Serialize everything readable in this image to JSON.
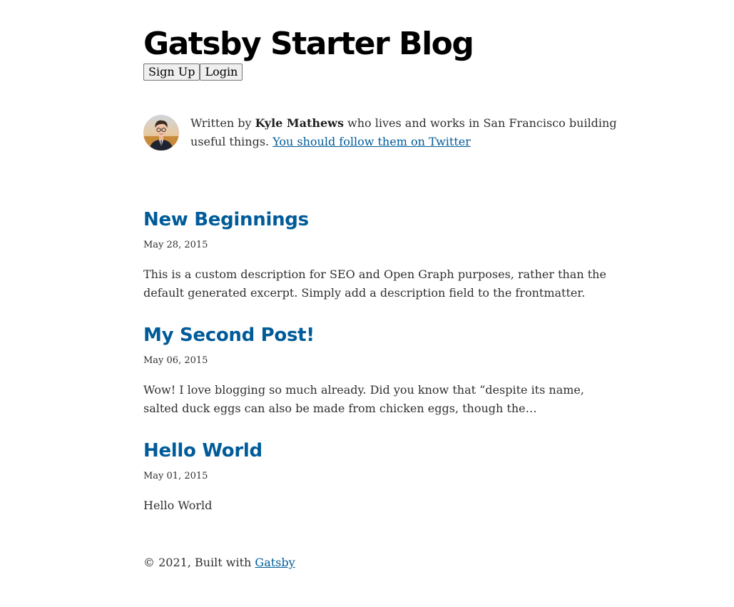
{
  "header": {
    "title": "Gatsby Starter Blog",
    "signup_label": "Sign Up",
    "login_label": "Login"
  },
  "bio": {
    "prefix": "Written by ",
    "author": "Kyle Mathews",
    "middle": " who lives and works in San Francisco building",
    "line2": "useful things. ",
    "twitter_link": "You should follow them on Twitter"
  },
  "posts": [
    {
      "title": "New Beginnings",
      "date": "May 28, 2015",
      "desc_line1": "This is a custom description for SEO and Open Graph purposes, rather than the",
      "desc_line2": "default generated excerpt. Simply add a description field to the frontmatter."
    },
    {
      "title": "My Second Post!",
      "date": "May 06, 2015",
      "desc_line1": "Wow! I love blogging so much already. Did you know that “despite its name,",
      "desc_line2": "salted duck eggs can also be made from chicken eggs, though the…"
    },
    {
      "title": "Hello World",
      "date": "May 01, 2015",
      "desc_line1": "Hello World",
      "desc_line2": ""
    }
  ],
  "footer": {
    "text": "© 2021, Built with ",
    "link": "Gatsby"
  },
  "colors": {
    "link": "#005b99",
    "title": "#000000",
    "text": "#2f2f2f"
  }
}
